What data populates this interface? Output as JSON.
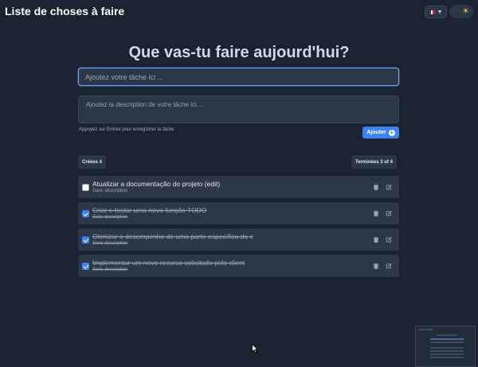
{
  "header": {
    "title": "Liste de choses à faire",
    "language_flag": "flag-fr-icon",
    "language_chevron": "chevron-down-icon",
    "theme_icon": "sun-icon"
  },
  "main": {
    "heading": "Que vas-tu faire aujourd'hui?",
    "task_input": {
      "placeholder": "Ajoutez votre tâche ici ...",
      "value": ""
    },
    "description_input": {
      "placeholder": "Ajoutez la description de votre tâche ici ...",
      "value": ""
    },
    "hint": "Appuyez sur Entrée pour enregistrer la tâche",
    "add_button": "Ajouter",
    "created_badge": "Créées 4",
    "done_badge": "Terminées 3 of 4"
  },
  "tasks": [
    {
      "title": "Atualizar a documentação do projeto (edit)",
      "description": "Sans description",
      "done": false
    },
    {
      "title": "Criar e testar uma nova função TODO",
      "description": "Sans description",
      "done": true
    },
    {
      "title": "Otimizar o desempenho de uma parte específica do c",
      "description": "Sans description",
      "done": true
    },
    {
      "title": "Implementar um novo recurso solicitado pelo client",
      "description": "Sans description",
      "done": true
    }
  ],
  "colors": {
    "background": "#1b2330",
    "accent": "#3b82f6",
    "card": "#2d3748",
    "input_focus": "#6ea8ff"
  }
}
